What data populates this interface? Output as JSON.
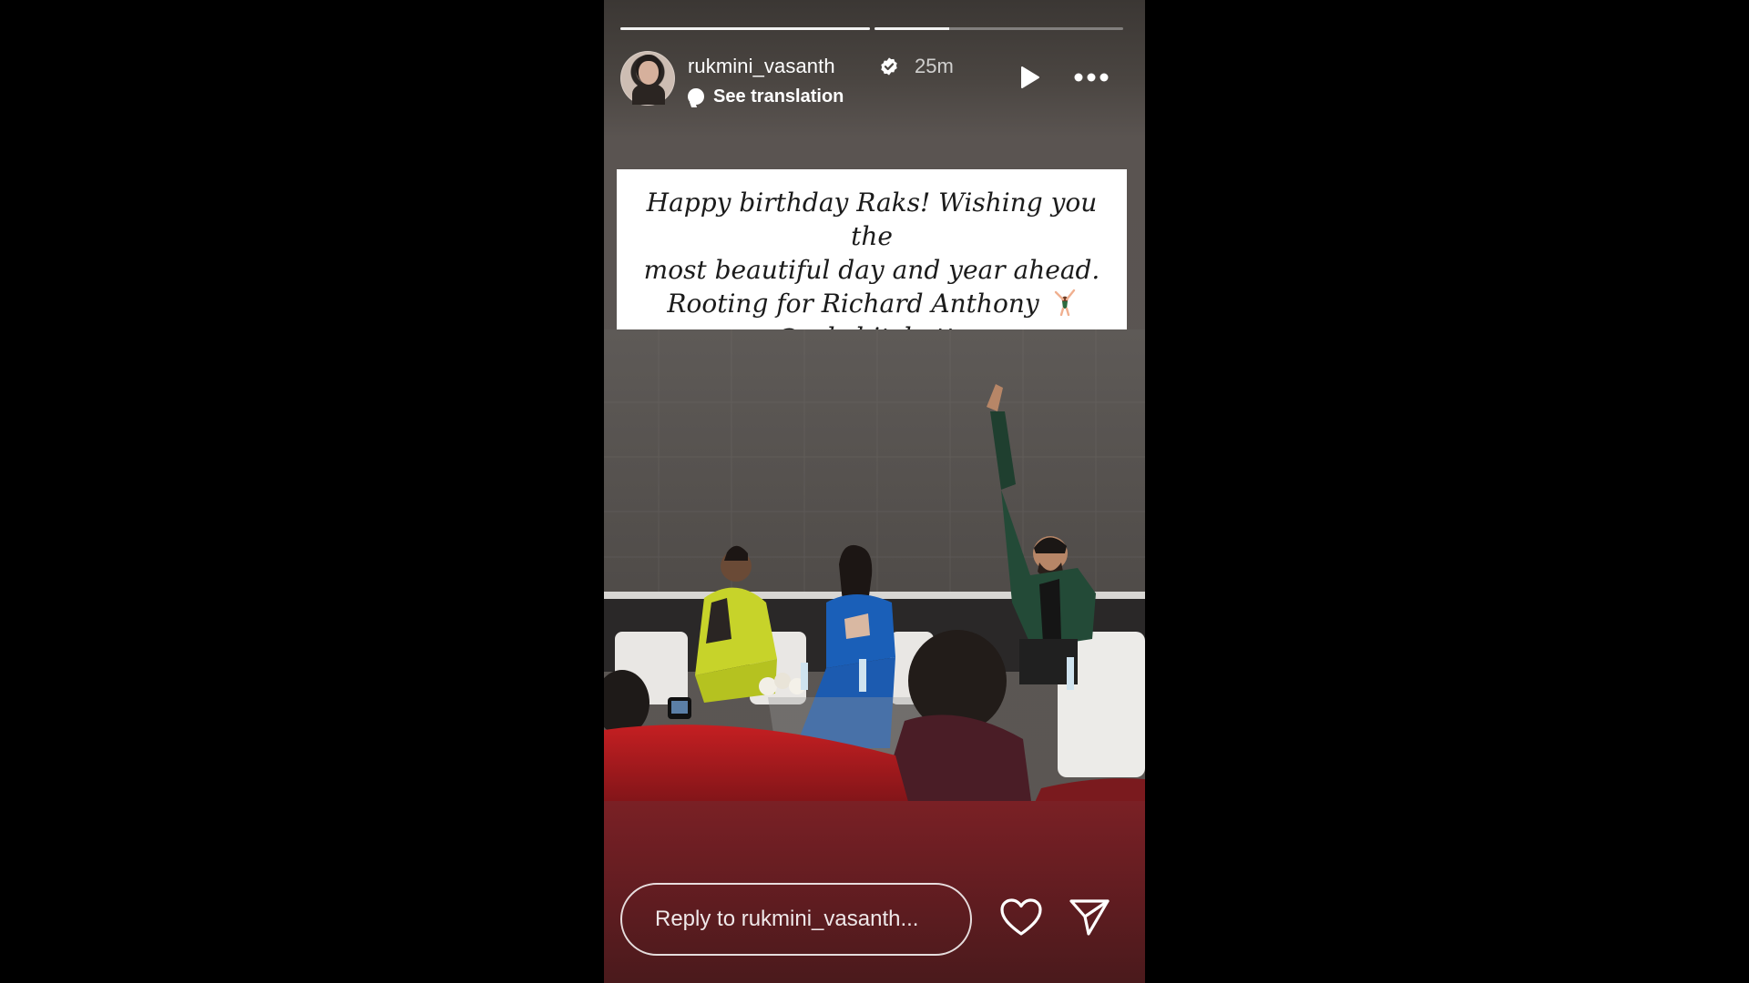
{
  "story": {
    "progress": [
      1.0,
      0.3
    ],
    "user": {
      "username": "rukmini_vasanth",
      "verified": true,
      "time_ago": "25m",
      "see_translation": "See translation"
    },
    "caption": {
      "line1": "Happy birthday Raks! Wishing you the",
      "line2": "most beautiful day and year ahead.",
      "line3": "Rooting for Richard Anthony",
      "mention": "@rakshitshetty"
    },
    "reply": {
      "placeholder": "Reply to rukmini_vasanth..."
    },
    "icons": {
      "play": "play-icon",
      "more": "more-horizontal-icon",
      "verified": "verified-badge-icon",
      "like": "heart-icon",
      "send": "send-icon"
    },
    "colors": {
      "background": "#000000",
      "bottom_fade": "#7a2025",
      "verified_badge": "#ffffff"
    }
  }
}
